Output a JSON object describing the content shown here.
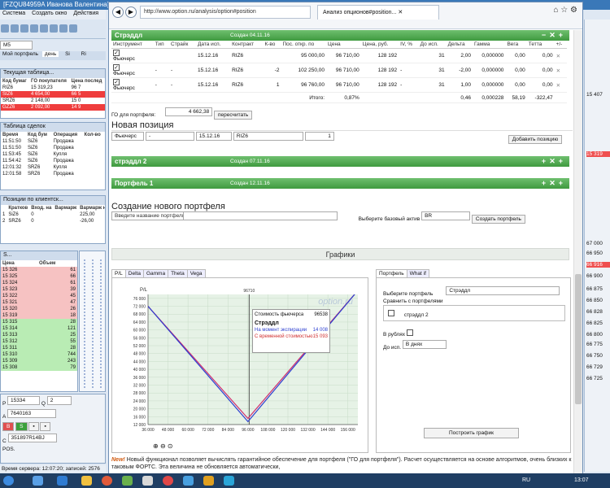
{
  "background_app": {
    "title": "[FZQU84959A Иванова Валентина]",
    "menu": [
      "Система",
      "Создать окно",
      "Действия"
    ],
    "instrument_select": "M5",
    "left_tabs": [
      "Мой портфель",
      "день",
      "Si",
      "Ri"
    ],
    "quotes_panel": {
      "title": "Текущая таблица...",
      "headers": [
        "Код бумаг",
        "ГО покупателя",
        "Цена послед"
      ],
      "rows": [
        {
          "code": "RIZ6",
          "go": "15 319,23",
          "last": "96 7",
          "style": "plain"
        },
        {
          "code": "SIZ6",
          "go": "4 654,00",
          "last": "66 5",
          "style": "red"
        },
        {
          "code": "SRZ6",
          "go": "2 148,00",
          "last": "15 0",
          "style": "plain"
        },
        {
          "code": "GZZ6",
          "go": "2 092,00",
          "last": "14 9",
          "style": "red"
        }
      ]
    },
    "deals_panel": {
      "title": "Таблица сделок",
      "headers": [
        "Время",
        "Код бум",
        "Операция",
        "Кол-во"
      ],
      "rows": [
        {
          "time": "11:51:50",
          "code": "SiZ6",
          "op": "Продажа"
        },
        {
          "time": "11:51:50",
          "code": "SiZ6",
          "op": "Продажа"
        },
        {
          "time": "11:53:45",
          "code": "SiZ6",
          "op": "Купля"
        },
        {
          "time": "11:54:42",
          "code": "SiZ6",
          "op": "Продажа"
        },
        {
          "time": "12:01:32",
          "code": "SRZ6",
          "op": "Купля"
        },
        {
          "time": "12:01:58",
          "code": "SRZ6",
          "op": "Продажа"
        }
      ]
    },
    "positions_panel": {
      "title": "Позиции по клиентск...",
      "headers": [
        "",
        "Кратков",
        "Вход. на",
        "Вармарж",
        "Вармарж наиж"
      ],
      "rows": [
        {
          "n": "1",
          "code": "SiZ6",
          "in": "0",
          "val": "225,00"
        },
        {
          "n": "2",
          "code": "SRZ6",
          "in": "0",
          "val": "-26,00"
        }
      ]
    },
    "orderbook": {
      "title": "S...",
      "headers": [
        "Цена",
        "Объем"
      ],
      "rows": [
        {
          "p": "15 326",
          "v": "61",
          "s": "pink"
        },
        {
          "p": "15 325",
          "v": "66",
          "s": "pink"
        },
        {
          "p": "15 324",
          "v": "61",
          "s": "pink"
        },
        {
          "p": "15 323",
          "v": "39",
          "s": "pink"
        },
        {
          "p": "15 322",
          "v": "45",
          "s": "pink"
        },
        {
          "p": "15 321",
          "v": "47",
          "s": "pink"
        },
        {
          "p": "15 320",
          "v": "26",
          "s": "pink"
        },
        {
          "p": "15 319",
          "v": "18",
          "s": "pink"
        },
        {
          "p": "15 315",
          "v": "28",
          "s": "green"
        },
        {
          "p": "15 314",
          "v": "121",
          "s": "green"
        },
        {
          "p": "15 313",
          "v": "25",
          "s": "green"
        },
        {
          "p": "15 312",
          "v": "55",
          "s": "green"
        },
        {
          "p": "15 311",
          "v": "28",
          "s": "green"
        },
        {
          "p": "15 310",
          "v": "744",
          "s": "green"
        },
        {
          "p": "15 309",
          "v": "243",
          "s": "green"
        },
        {
          "p": "15 308",
          "v": "79",
          "s": "green"
        }
      ]
    },
    "order_form": {
      "price": "15334",
      "qty": "2",
      "account": "7640163",
      "client": "351897R14BJ",
      "pos": "POS."
    },
    "status_text": "Время сервера: 12:07:20; записей: 2576",
    "right_numbers": [
      "15 407",
      "15 319",
      "67 000",
      "66 950",
      "66 916",
      "66 900",
      "66 875",
      "66 850",
      "66 828",
      "66 825",
      "66 800",
      "66 775",
      "66 750",
      "66 729",
      "66 725"
    ],
    "right_highlight": "15 319",
    "right_highlight2": "66 775"
  },
  "browser": {
    "url": "http://www.option.ru/analysis/option#position",
    "tab_title": "Анализ опционов#position...",
    "portfolio1": {
      "name": "Стрэддл",
      "created": "Создан 04.11.16",
      "headers": [
        "Инструмент",
        "Тип",
        "Страйк",
        "Дата исп.",
        "Контракт",
        "К-во",
        "Пос. откр. по",
        "Цена",
        "Цена, руб.",
        "IV, %",
        "До исп.",
        "Дельта",
        "Гамма",
        "Вега",
        "Тетта",
        "+/-"
      ],
      "rows": [
        {
          "instr": "Фьючерс",
          "type": "",
          "strike": "",
          "date": "15.12.16",
          "contract": "RIZ6",
          "qty": "",
          "open": "95 000,00",
          "price": "96 710,00",
          "rub": "128 192",
          "iv": "",
          "days": "31",
          "delta": "2,00",
          "gamma": "0,000000",
          "vega": "0,00",
          "theta": "0,00"
        },
        {
          "instr": "Фьючерс",
          "type": "-",
          "strike": "-",
          "date": "15.12.16",
          "contract": "RIZ6",
          "qty": "-2",
          "open": "102 250,00",
          "price": "96 710,00",
          "rub": "128 192",
          "iv": "-",
          "days": "31",
          "delta": "-2,00",
          "gamma": "0,000000",
          "vega": "0,00",
          "theta": "0,00"
        },
        {
          "instr": "Фьючерс",
          "type": "-",
          "strike": "-",
          "date": "15.12.16",
          "contract": "RIZ6",
          "qty": "1",
          "open": "96 760,00",
          "price": "96 710,00",
          "rub": "128 192",
          "iv": "-",
          "days": "31",
          "delta": "1,00",
          "gamma": "0,000000",
          "vega": "0,00",
          "theta": "0,00"
        }
      ],
      "total_label": "Итого:",
      "total_pct": "0,87%",
      "total_delta": "0,46",
      "total_gamma": "0,000228",
      "total_vega": "58,19",
      "total_theta": "-322,47",
      "go_label": "ГО для портфеля:",
      "go_value": "4 662,38",
      "recalc_btn": "пересчитать",
      "new_position_title": "Новая позиция",
      "new_pos": {
        "instr": "Фьючерс",
        "type": "-",
        "date": "15.12.16",
        "contract": "RIZ6",
        "qty": "1"
      },
      "add_btn": "Добавить позицию"
    },
    "portfolio2": {
      "name": "стрэддл 2",
      "created": "Создан 07.11.16"
    },
    "portfolio3": {
      "name": "Портфель 1",
      "created": "Создан 12.11.16"
    },
    "create_portfolio": {
      "title": "Создание нового портфеля",
      "name_placeholder": "Введите название портфеля",
      "base_label": "Выберите базовый актив",
      "base_value": "BR",
      "create_btn": "Создать портфель"
    },
    "charts_title": "Графики",
    "chart_tabs": [
      "P/L",
      "Delta",
      "Gamma",
      "Theta",
      "Vega"
    ],
    "side_tabs": [
      "Портфель",
      "What if"
    ],
    "side": {
      "select_label": "Выберите портфель",
      "select_value": "Стрэддл",
      "compare_label": "Сравнить с портфелями",
      "compare_item": "стрэддл 2",
      "rub_label": "В рублях",
      "days_label": "До исп.",
      "days_value": "В днях",
      "build_btn": "Построить график"
    },
    "tooltip": {
      "futures_label": "Стоимость фьючерса",
      "futures_value": "96538",
      "name": "Стрэддл",
      "expiry_label": "На момент экспирации",
      "expiry_value": "14 008",
      "time_label": "С временной стоимостью",
      "time_value": "15 093"
    },
    "watermark": "option.ru",
    "note_badge": "New!",
    "note_text": "Новый функционал позволяет вычислять гарантийное обеспечение для портфеля (\"ГО для портфеля\"). Расчет осуществляется на основе алгоритмов, очень близких к таковым ФОРТС. Эта величина не обновляется автоматически,"
  },
  "chart_data": {
    "type": "line",
    "ylabel": "P/L",
    "marker_label": "96710",
    "x_ticks": [
      "36 000",
      "48 000",
      "60 000",
      "72 000",
      "84 000",
      "96 000",
      "108 000",
      "120 000",
      "132 000",
      "144 000",
      "156 000"
    ],
    "y_ticks": [
      "12 000",
      "16 000",
      "20 000",
      "24 000",
      "28 000",
      "32 000",
      "36 000",
      "40 000",
      "44 000",
      "48 000",
      "52 000",
      "56 000",
      "60 000",
      "64 000",
      "68 000",
      "72 000",
      "76 000"
    ],
    "xlim": [
      36000,
      162000
    ],
    "ylim": [
      12000,
      78000
    ],
    "series": [
      {
        "name": "На момент экспирации",
        "color": "#2d3fd0",
        "x": [
          36000,
          96000,
          162000
        ],
        "y": [
          72000,
          13500,
          80000
        ]
      },
      {
        "name": "С временной стоимостью",
        "color": "#d02d6e",
        "x": [
          36000,
          96000,
          162000
        ],
        "y": [
          72000,
          15100,
          80000
        ]
      }
    ]
  },
  "taskbar": {
    "lang": "RU",
    "time": "13:07"
  }
}
